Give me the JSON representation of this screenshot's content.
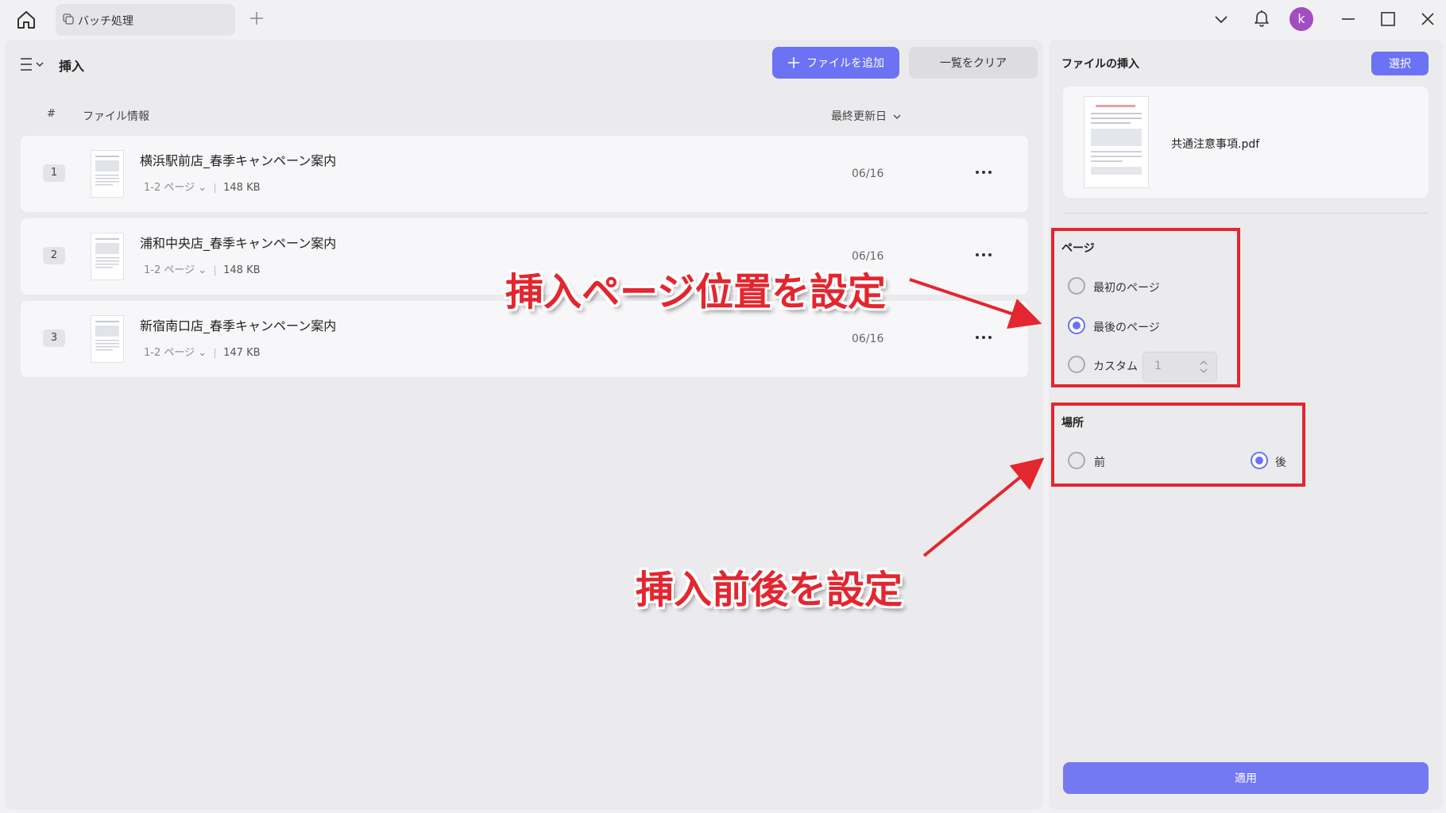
{
  "tabbar": {
    "tab_label": "バッチ処理",
    "avatar_letter": "k"
  },
  "left": {
    "title": "挿入",
    "add_files_label": "ファイルを追加",
    "clear_list_label": "一覧をクリア",
    "columns": {
      "index": "#",
      "file_info": "ファイル情報",
      "modified": "最終更新日"
    },
    "files": [
      {
        "index": "1",
        "name": "横浜駅前店_春季キャンペーン案内",
        "pages": "1-2 ページ",
        "size": "148 KB",
        "date": "06/16"
      },
      {
        "index": "2",
        "name": "浦和中央店_春季キャンペーン案内",
        "pages": "1-2 ページ",
        "size": "148 KB",
        "date": "06/16"
      },
      {
        "index": "3",
        "name": "新宿南口店_春季キャンペーン案内",
        "pages": "1-2 ページ",
        "size": "147 KB",
        "date": "06/16"
      }
    ]
  },
  "right": {
    "title": "ファイルの挿入",
    "select_label": "選択",
    "insert_file_name": "共通注意事項.pdf",
    "page_section": {
      "label": "ページ",
      "options": [
        "最初のページ",
        "最後のページ",
        "カスタム"
      ],
      "selected": "最後のページ",
      "custom_value": "1"
    },
    "location_section": {
      "label": "場所",
      "options": [
        "前",
        "後"
      ],
      "selected": "後"
    },
    "apply_label": "適用"
  },
  "annotations": {
    "page_position_text": "挿入ページ位置を設定",
    "before_after_text": "挿入前後を設定",
    "color": "#e3262f"
  },
  "colors": {
    "accent": "#6b72f3",
    "avatar": "#a24dc0"
  }
}
